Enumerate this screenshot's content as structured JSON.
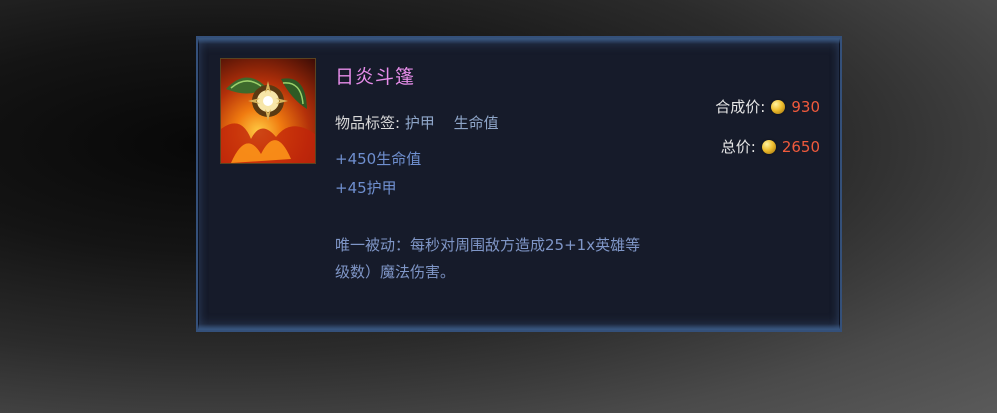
{
  "item": {
    "name": "日炎斗篷",
    "icon": "sunfire-cape-icon",
    "tags_label": "物品标签:",
    "tag_1": "护甲",
    "tag_2": "生命值",
    "stats": [
      "+450生命值",
      "+45护甲"
    ],
    "passive_line_1": "唯一被动：每秒对周围敌方造成25+1x英雄等",
    "passive_line_2": "级数）魔法伤害。"
  },
  "price": {
    "combine_label": "合成价:",
    "combine_value": "930",
    "total_label": "总价:",
    "total_value": "2650",
    "coin_icon": "gold-coin-icon"
  },
  "colors": {
    "title": "#e58ce8",
    "stat": "#6f8fcf",
    "price": "#f05a3c",
    "panel": "#161b2a",
    "border": "#34507a"
  }
}
